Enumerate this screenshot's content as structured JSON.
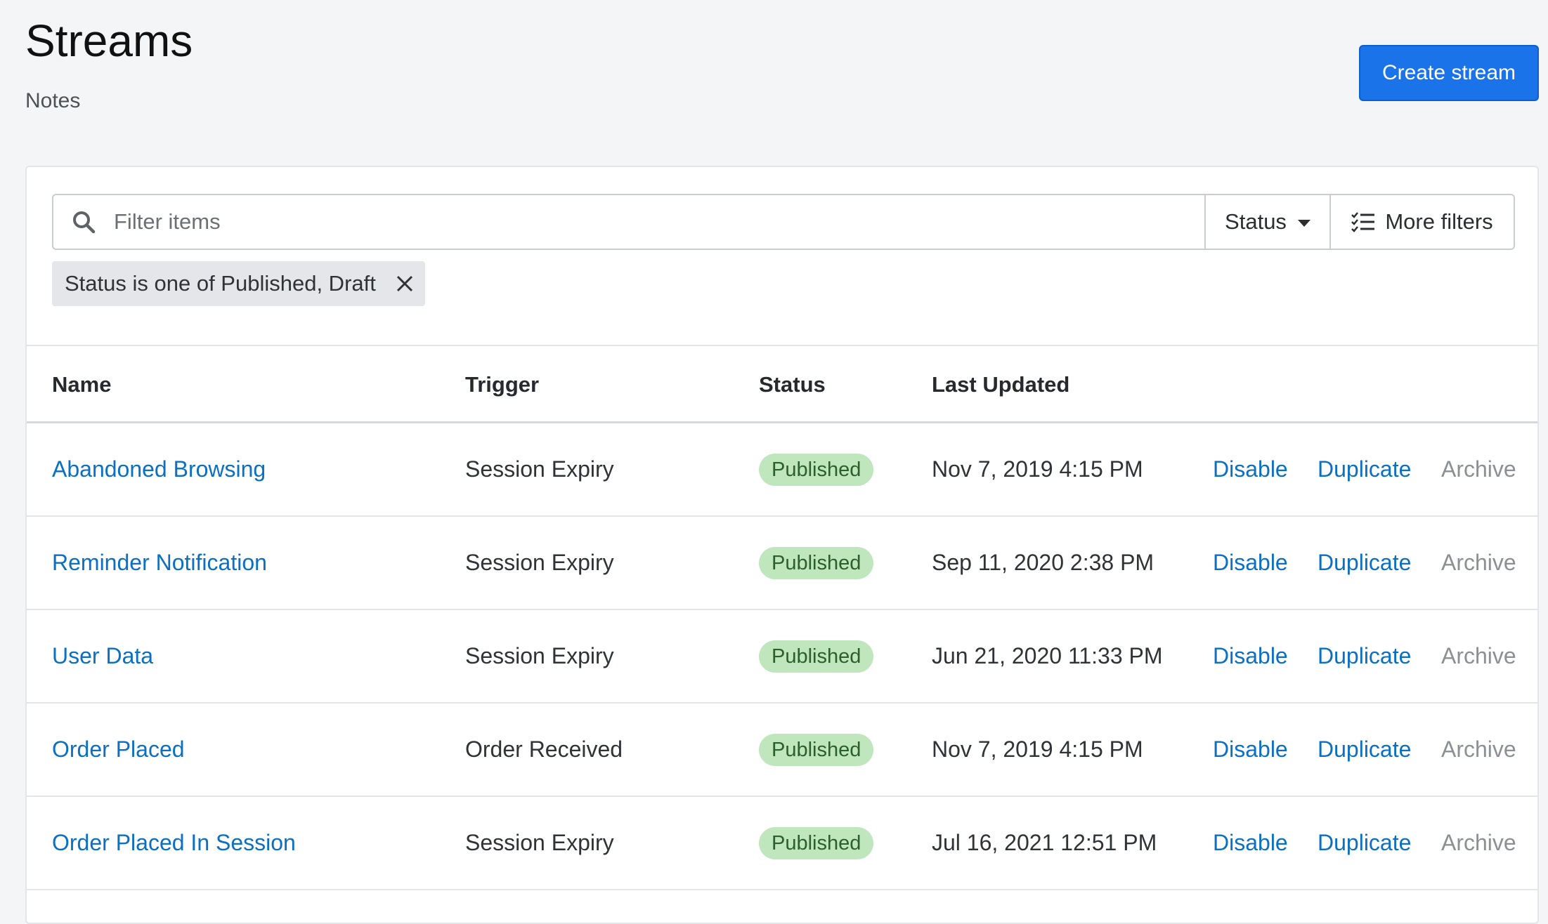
{
  "header": {
    "title": "Streams",
    "subtitle": "Notes",
    "create_label": "Create stream"
  },
  "filters": {
    "search_placeholder": "Filter items",
    "status_label": "Status",
    "more_filters_label": "More filters",
    "active_chip": "Status is one of Published, Draft"
  },
  "table": {
    "columns": {
      "name": "Name",
      "trigger": "Trigger",
      "status": "Status",
      "last_updated": "Last Updated"
    },
    "rows": [
      {
        "name": "Abandoned Browsing",
        "trigger": "Session Expiry",
        "status": "Published",
        "last_updated": "Nov 7, 2019 4:15 PM",
        "disable": "Disable",
        "duplicate": "Duplicate",
        "archive": "Archive"
      },
      {
        "name": "Reminder Notification",
        "trigger": "Session Expiry",
        "status": "Published",
        "last_updated": "Sep 11, 2020 2:38 PM",
        "disable": "Disable",
        "duplicate": "Duplicate",
        "archive": "Archive"
      },
      {
        "name": "User Data",
        "trigger": "Session Expiry",
        "status": "Published",
        "last_updated": "Jun 21, 2020 11:33 PM",
        "disable": "Disable",
        "duplicate": "Duplicate",
        "archive": "Archive"
      },
      {
        "name": "Order Placed",
        "trigger": "Order Received",
        "status": "Published",
        "last_updated": "Nov 7, 2019 4:15 PM",
        "disable": "Disable",
        "duplicate": "Duplicate",
        "archive": "Archive"
      },
      {
        "name": "Order Placed In Session",
        "trigger": "Session Expiry",
        "status": "Published",
        "last_updated": "Jul 16, 2021 12:51 PM",
        "disable": "Disable",
        "duplicate": "Duplicate",
        "archive": "Archive"
      }
    ]
  },
  "colors": {
    "primary": "#1a73e8",
    "link": "#0b6fc2",
    "published_badge_bg": "#bfe6bd",
    "archive_text": "#8b9095"
  }
}
